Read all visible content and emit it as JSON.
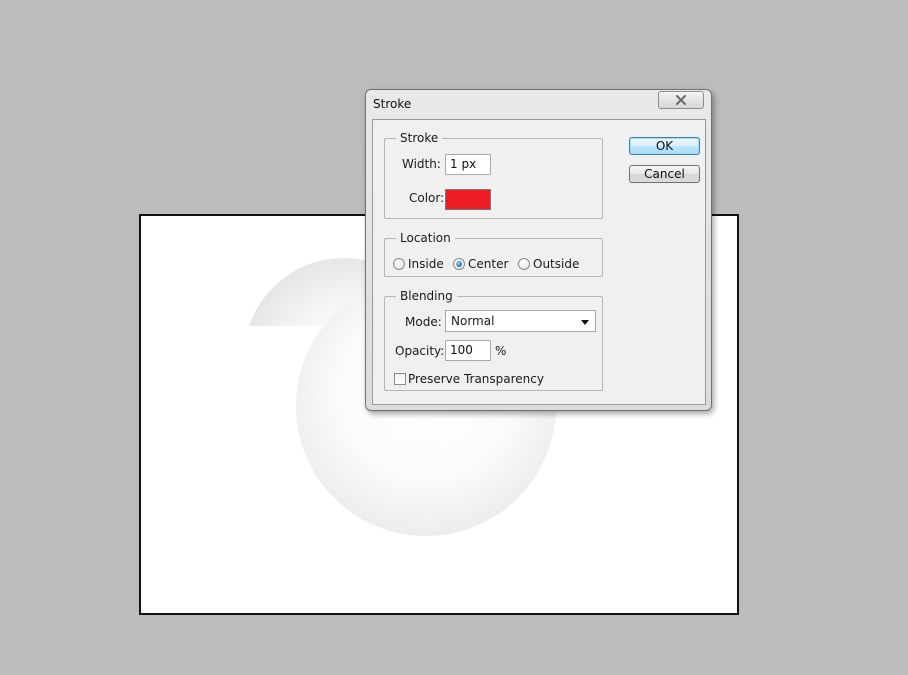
{
  "canvas": {
    "background": "#ffffff"
  },
  "dialog": {
    "title": "Stroke",
    "close_icon": "close-x-icon",
    "ok_label": "OK",
    "cancel_label": "Cancel",
    "stroke_group": {
      "title": "Stroke",
      "width_label": "Width:",
      "width_value": "1 px",
      "color_label": "Color:",
      "color_value": "#ee1c25"
    },
    "location_group": {
      "title": "Location",
      "options": [
        {
          "label": "Inside",
          "selected": false
        },
        {
          "label": "Center",
          "selected": true
        },
        {
          "label": "Outside",
          "selected": false
        }
      ]
    },
    "blending_group": {
      "title": "Blending",
      "mode_label": "Mode:",
      "mode_value": "Normal",
      "opacity_label": "Opacity:",
      "opacity_value": "100",
      "opacity_unit": "%",
      "preserve_label": "Preserve Transparency",
      "preserve_checked": false
    }
  },
  "colors": {
    "workspace": "#bcbcbc",
    "stroke_color": "#ee1c25",
    "ok_button_accent": "#3c7fb1"
  }
}
